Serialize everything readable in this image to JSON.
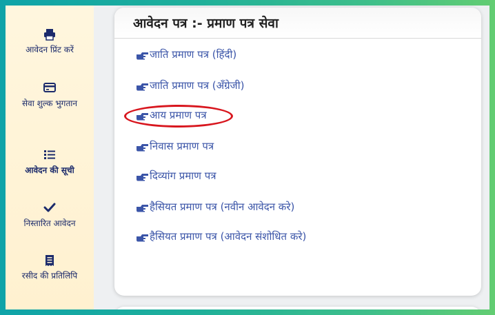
{
  "sidebar": {
    "items": [
      {
        "label": "आवेदन प्रिंट करें",
        "icon": "printer-icon"
      },
      {
        "label": "सेवा शुल्क भुगतान",
        "icon": "credit-card-icon"
      },
      {
        "label": "आवेदन की सूची",
        "icon": "list-icon",
        "active": true
      },
      {
        "label": "निस्तारित आवेदन",
        "icon": "checkmark-icon"
      },
      {
        "label": "रसीद की प्रतिलिपि",
        "icon": "receipt-icon"
      }
    ]
  },
  "card": {
    "title": "आवेदन पत्र :-  प्रमाण पत्र सेवा",
    "services": [
      {
        "label": "जाति प्रमाण पत्र (हिंदी)"
      },
      {
        "label": "जाति प्रमाण पत्र (अँग्रेजी)"
      },
      {
        "label": "आय प्रमाण पत्र",
        "highlighted": true
      },
      {
        "label": "निवास प्रमाण पत्र"
      },
      {
        "label": "दिव्यांग प्रमाण पत्र"
      },
      {
        "label": "हैसियत प्रमाण पत्र (नवीन आवेदन करे)"
      },
      {
        "label": "हैसियत प्रमाण पत्र (आवेदन संशोधित करे)"
      }
    ]
  },
  "colors": {
    "sidebar_text": "#1b2a6b",
    "link": "#3b55a8",
    "highlight_ring": "#d8161e",
    "sidebar_bg": "#fff3d6"
  }
}
